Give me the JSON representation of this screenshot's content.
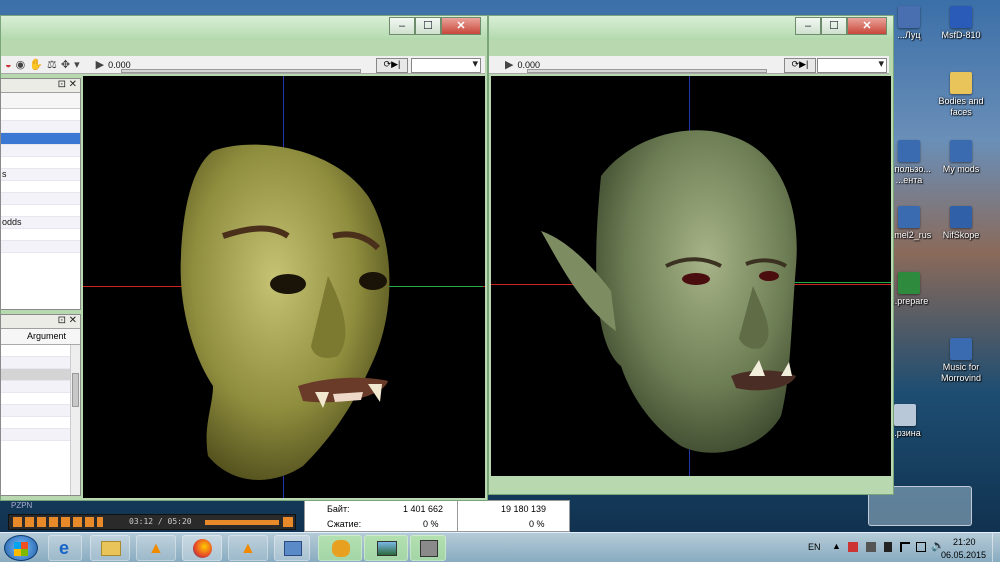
{
  "desktop_icons": [
    {
      "label": "...Луц",
      "icon": "app-icon",
      "color": "#4a6fb0"
    },
    {
      "label": "MsfD-810",
      "icon": "word-doc-icon",
      "color": "#2a5bb8"
    },
    {
      "label": "Bodies and faces",
      "icon": "folder-icon",
      "color": "#e8c45a"
    },
    {
      "label": "...пользо... ...ента",
      "icon": "shortcut-icon",
      "color": "#3a6ab0"
    },
    {
      "label": "My mods",
      "icon": "shortcut-icon",
      "color": "#3a6ab0"
    },
    {
      "label": "...mel2_rus",
      "icon": "shortcut-icon",
      "color": "#3a6ab0"
    },
    {
      "label": "NifSkope",
      "icon": "nifskope-icon",
      "color": "#3060a8"
    },
    {
      "label": "...prepare",
      "icon": "excel-icon",
      "color": "#2e8a3c"
    },
    {
      "label": "Music for Morrovind",
      "icon": "shortcut-icon",
      "color": "#3a6ab0"
    },
    {
      "label": "...рзина",
      "icon": "recycle-bin-icon",
      "color": "#b8c8d8"
    }
  ],
  "left_window": {
    "time": "0.000",
    "tree_rows": [
      "",
      "",
      "",
      "",
      "",
      "s",
      "",
      "",
      "",
      "odds",
      "",
      ""
    ],
    "arguments_header": "Argument"
  },
  "right_window": {
    "time": "0.000"
  },
  "stats": {
    "row1_label": "Байт:",
    "row1_value": "1 401 662",
    "row1_value2": "19 180 139",
    "row2_label": "Сжатие:",
    "row2_value": "0 %",
    "row2_value2": "0 %"
  },
  "player": {
    "time": "03:12 / 05:20",
    "brand": "PZPN"
  },
  "taskbar": {
    "language": "EN",
    "clock_time": "21:20",
    "clock_date": "06.05.2015"
  },
  "colors": {
    "selection": "#3a78d4",
    "axis_x": "#cc2222",
    "axis_y": "#2233aa",
    "axis_z": "#22aa44"
  }
}
